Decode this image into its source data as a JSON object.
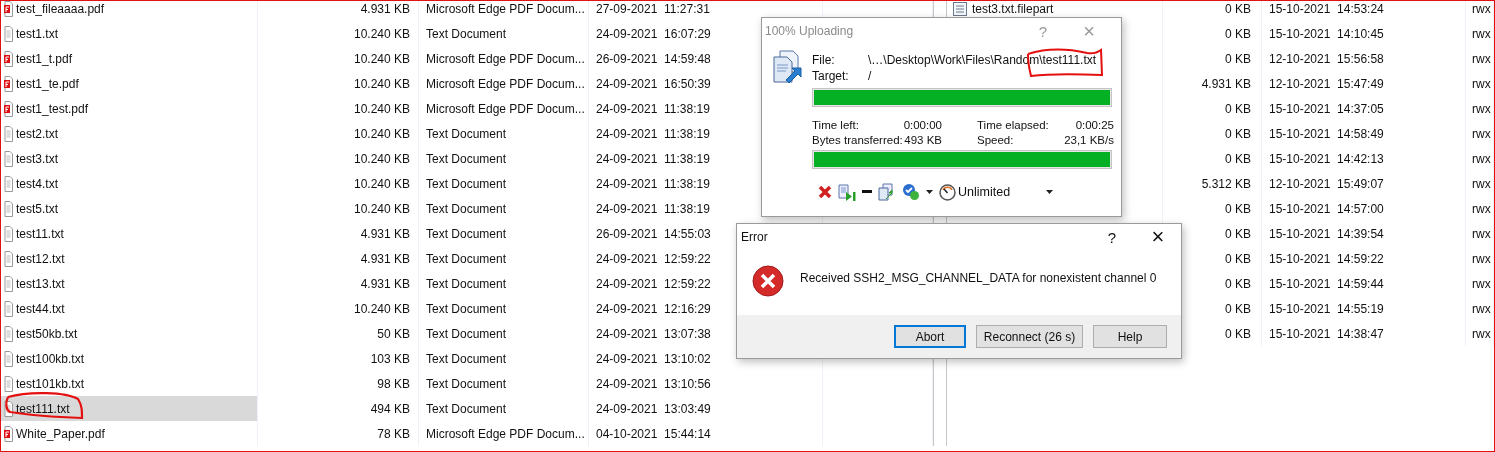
{
  "left_pane": {
    "rows": [
      {
        "name": "test_fileaaaa.pdf",
        "kind": "pdf",
        "size": "4.931 KB",
        "type": "Microsoft Edge PDF Docum...",
        "modified": "27-09-2021  11:27:31",
        "selected": false
      },
      {
        "name": "test1.txt",
        "kind": "txt",
        "size": "10.240 KB",
        "type": "Text Document",
        "modified": "24-09-2021  16:07:29",
        "selected": false
      },
      {
        "name": "test1_t.pdf",
        "kind": "pdf",
        "size": "10.240 KB",
        "type": "Microsoft Edge PDF Docum...",
        "modified": "26-09-2021  14:59:48",
        "selected": false
      },
      {
        "name": "test1_te.pdf",
        "kind": "pdf",
        "size": "10.240 KB",
        "type": "Microsoft Edge PDF Docum...",
        "modified": "24-09-2021  16:50:39",
        "selected": false
      },
      {
        "name": "test1_test.pdf",
        "kind": "pdf",
        "size": "10.240 KB",
        "type": "Microsoft Edge PDF Docum...",
        "modified": "24-09-2021  11:38:19",
        "selected": false
      },
      {
        "name": "test2.txt",
        "kind": "txt",
        "size": "10.240 KB",
        "type": "Text Document",
        "modified": "24-09-2021  11:38:19",
        "selected": false
      },
      {
        "name": "test3.txt",
        "kind": "txt",
        "size": "10.240 KB",
        "type": "Text Document",
        "modified": "24-09-2021  11:38:19",
        "selected": false
      },
      {
        "name": "test4.txt",
        "kind": "txt",
        "size": "10.240 KB",
        "type": "Text Document",
        "modified": "24-09-2021  11:38:19",
        "selected": false
      },
      {
        "name": "test5.txt",
        "kind": "txt",
        "size": "10.240 KB",
        "type": "Text Document",
        "modified": "24-09-2021  11:38:19",
        "selected": false
      },
      {
        "name": "test11.txt",
        "kind": "txt",
        "size": "4.931 KB",
        "type": "Text Document",
        "modified": "26-09-2021  14:55:03",
        "selected": false
      },
      {
        "name": "test12.txt",
        "kind": "txt",
        "size": "4.931 KB",
        "type": "Text Document",
        "modified": "24-09-2021  12:59:22",
        "selected": false
      },
      {
        "name": "test13.txt",
        "kind": "txt",
        "size": "4.931 KB",
        "type": "Text Document",
        "modified": "24-09-2021  12:59:22",
        "selected": false
      },
      {
        "name": "test44.txt",
        "kind": "txt",
        "size": "10.240 KB",
        "type": "Text Document",
        "modified": "24-09-2021  12:16:29",
        "selected": false
      },
      {
        "name": "test50kb.txt",
        "kind": "txt",
        "size": "50 KB",
        "type": "Text Document",
        "modified": "24-09-2021  13:07:38",
        "selected": false
      },
      {
        "name": "test100kb.txt",
        "kind": "txt",
        "size": "103 KB",
        "type": "Text Document",
        "modified": "24-09-2021  13:10:02",
        "selected": false
      },
      {
        "name": "test101kb.txt",
        "kind": "txt",
        "size": "98 KB",
        "type": "Text Document",
        "modified": "24-09-2021  13:10:56",
        "selected": false
      },
      {
        "name": "test111.txt",
        "kind": "txt",
        "size": "494 KB",
        "type": "Text Document",
        "modified": "24-09-2021  13:03:49",
        "selected": true
      },
      {
        "name": "White_Paper.pdf",
        "kind": "pdf",
        "size": "78 KB",
        "type": "Microsoft Edge PDF Docum...",
        "modified": "04-10-2021  15:44:14",
        "selected": false
      }
    ]
  },
  "right_pane": {
    "rows": [
      {
        "name": "test3.txt.filepart",
        "size": "0 KB",
        "modified": "15-10-2021  14:53:24",
        "permissions": "rwx"
      },
      {
        "size": "0 KB",
        "modified": "15-10-2021  14:10:45",
        "permissions": "rwx"
      },
      {
        "size": "0 KB",
        "modified": "12-10-2021  15:56:58",
        "permissions": "rwx"
      },
      {
        "size": "4.931 KB",
        "modified": "12-10-2021  15:47:49",
        "permissions": "rwx"
      },
      {
        "size": "0 KB",
        "modified": "15-10-2021  14:37:05",
        "permissions": "rwx"
      },
      {
        "size": "0 KB",
        "modified": "15-10-2021  14:58:49",
        "permissions": "rwx"
      },
      {
        "size": "0 KB",
        "modified": "15-10-2021  14:42:13",
        "permissions": "rwx"
      },
      {
        "size": "5.312 KB",
        "modified": "12-10-2021  15:49:07",
        "permissions": "rwx"
      },
      {
        "size": "0 KB",
        "modified": "15-10-2021  14:57:00",
        "permissions": "rwx"
      },
      {
        "size": "0 KB",
        "modified": "15-10-2021  14:39:54",
        "permissions": "rwx"
      },
      {
        "size": "0 KB",
        "modified": "15-10-2021  14:59:22",
        "permissions": "rwx"
      },
      {
        "size": "0 KB",
        "modified": "15-10-2021  14:59:44",
        "permissions": "rwx"
      },
      {
        "size": "0 KB",
        "modified": "15-10-2021  14:55:19",
        "permissions": "rwx"
      },
      {
        "size": "0 KB",
        "modified": "15-10-2021  14:38:47",
        "permissions": "rwx"
      }
    ]
  },
  "upload_dialog": {
    "title": "100% Uploading",
    "help": "?",
    "close": "×",
    "file_label": "File:",
    "file": "\\…\\Desktop\\Work\\Files\\Random\\test111.txt",
    "target_label": "Target:",
    "target": "/",
    "file_progress": {
      "level": 1
    },
    "stats": [
      {
        "label": "Time left:",
        "value": "0:00:00"
      },
      {
        "label": "Time elapsed:",
        "value": "0:00:25"
      },
      {
        "label": "Bytes transferred:",
        "value": "493 KB"
      },
      {
        "label": "Speed:",
        "value": "23,1 KB/s"
      }
    ],
    "total_progress": {
      "level": 1
    },
    "speed_limit": "Unlimited"
  },
  "error_dialog": {
    "title": "Error",
    "help": "?",
    "close": "×",
    "message": "Received SSH2_MSG_CHANNEL_DATA for nonexistent channel 0",
    "buttons": [
      {
        "label": "Abort",
        "default": true
      },
      {
        "label": "Reconnect (26 s)",
        "default": false
      },
      {
        "label": "Help",
        "default": false
      }
    ]
  }
}
